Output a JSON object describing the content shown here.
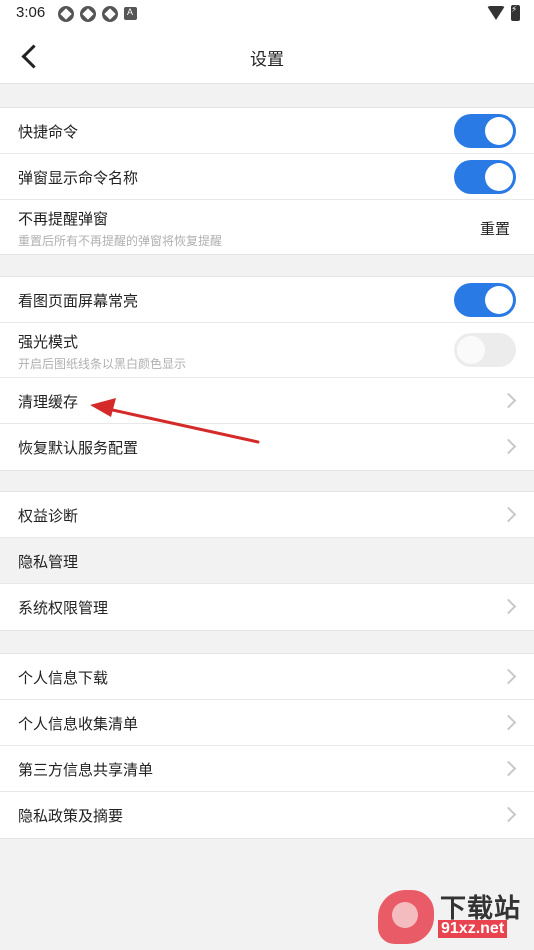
{
  "status_bar": {
    "time": "3:06"
  },
  "header": {
    "title": "设置"
  },
  "group1": {
    "quick_command": {
      "label": "快捷命令",
      "enabled": true
    },
    "popup_command_name": {
      "label": "弹窗显示命令名称",
      "enabled": true
    },
    "no_remind_popup": {
      "label": "不再提醒弹窗",
      "sub": "重置后所有不再提醒的弹窗将恢复提醒",
      "action": "重置"
    }
  },
  "group2": {
    "screen_always_on": {
      "label": "看图页面屏幕常亮",
      "enabled": true
    },
    "high_light_mode": {
      "label": "强光模式",
      "sub": "开启后图纸线条以黑白颜色显示",
      "enabled": false
    },
    "clear_cache": {
      "label": "清理缓存"
    },
    "restore_default": {
      "label": "恢复默认服务配置"
    }
  },
  "group3": {
    "rights_diagnosis": {
      "label": "权益诊断"
    },
    "privacy_header": "隐私管理",
    "system_permissions": {
      "label": "系统权限管理"
    }
  },
  "group4": {
    "items": [
      {
        "label": "个人信息下载"
      },
      {
        "label": "个人信息收集清单"
      },
      {
        "label": "第三方信息共享清单"
      },
      {
        "label": "隐私政策及摘要"
      }
    ]
  },
  "watermark": {
    "text": "下载站",
    "url": "91xz.net"
  },
  "colors": {
    "toggle_on": "#2a7ae6",
    "background": "#f2f2f2",
    "annotation_arrow": "#d42a2a"
  }
}
